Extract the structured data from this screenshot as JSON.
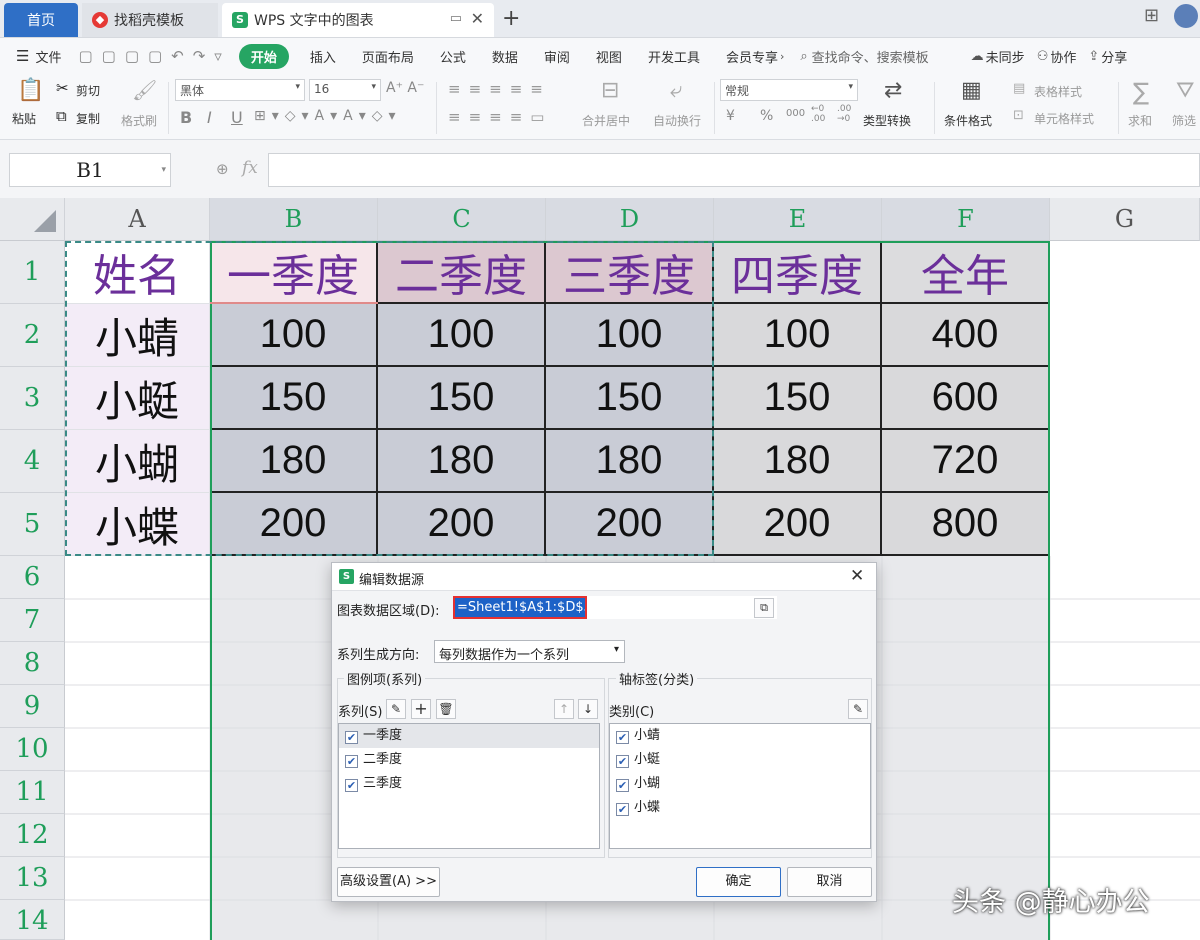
{
  "tabs": {
    "home": "首页",
    "template": "找稻壳模板",
    "doc": "WPS 文字中的图表"
  },
  "menu": {
    "file": "文件",
    "items": [
      "开始",
      "插入",
      "页面布局",
      "公式",
      "数据",
      "审阅",
      "视图",
      "开发工具",
      "会员专享"
    ],
    "search": "查找命令、搜索模板",
    "sync": "未同步",
    "collab": "协作",
    "share": "分享"
  },
  "ribbon": {
    "paste": "粘贴",
    "cut": "剪切",
    "copy": "复制",
    "format_painter": "格式刷",
    "font": "黑体",
    "size": "16",
    "bold": "B",
    "italic": "I",
    "underline": "U",
    "merge": "合并居中",
    "wrap": "自动换行",
    "number_format": "常规",
    "type_convert": "类型转换",
    "cond_format": "条件格式",
    "table_style": "表格样式",
    "cell_style": "单元格样式",
    "sum": "求和",
    "filter": "筛选",
    "currency": "¥",
    "percent": "%",
    "thousands": "000",
    "inc_dec": "←0 .00",
    "dec_dec": ".00 →0"
  },
  "formula": {
    "cell_ref": "B1",
    "fx": "fx"
  },
  "columns": [
    "A",
    "B",
    "C",
    "D",
    "E",
    "F",
    "G"
  ],
  "rows": [
    "1",
    "2",
    "3",
    "4",
    "5",
    "6",
    "7",
    "8",
    "9",
    "10",
    "11",
    "12",
    "13",
    "14"
  ],
  "table": {
    "header": [
      "姓名",
      "一季度",
      "二季度",
      "三季度",
      "四季度",
      "全年"
    ],
    "data": [
      [
        "小蜻",
        "100",
        "100",
        "100",
        "100",
        "400"
      ],
      [
        "小蜓",
        "150",
        "150",
        "150",
        "150",
        "600"
      ],
      [
        "小蝴",
        "180",
        "180",
        "180",
        "180",
        "720"
      ],
      [
        "小蝶",
        "200",
        "200",
        "200",
        "200",
        "800"
      ]
    ]
  },
  "dialog": {
    "title": "编辑数据源",
    "range_label": "图表数据区域(D):",
    "range_value": "=Sheet1!$A$1:$D$5",
    "direction_label": "系列生成方向:",
    "direction_value": "每列数据作为一个系列",
    "legend_group": "图例项(系列)",
    "axis_group": "轴标签(分类)",
    "series_label": "系列(S)",
    "category_label": "类别(C)",
    "series": [
      "一季度",
      "二季度",
      "三季度"
    ],
    "categories": [
      "小蜻",
      "小蜓",
      "小蝴",
      "小蝶"
    ],
    "advanced": "高级设置(A) >>",
    "ok": "确定",
    "cancel": "取消"
  },
  "watermark": "头条 @静心办公",
  "colors": {
    "accent": "#26a563",
    "header_text": "#6b2f9a",
    "selection_green": "#1f9e5a",
    "range_highlight": "#1d62c7"
  }
}
